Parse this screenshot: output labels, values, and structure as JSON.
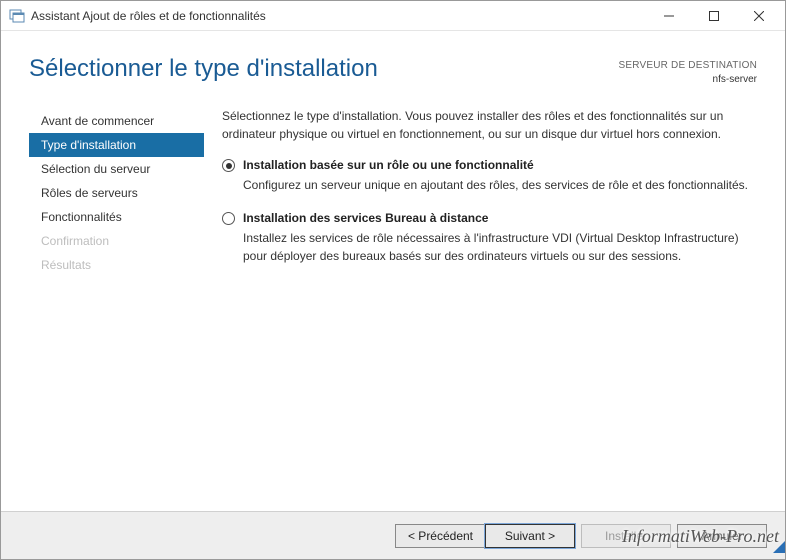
{
  "window": {
    "title": "Assistant Ajout de rôles et de fonctionnalités"
  },
  "header": {
    "page_title": "Sélectionner le type d'installation",
    "destination_label": "SERVEUR DE DESTINATION",
    "destination_value": "nfs-server"
  },
  "steps": [
    {
      "label": "Avant de commencer",
      "state": "done"
    },
    {
      "label": "Type d'installation",
      "state": "active"
    },
    {
      "label": "Sélection du serveur",
      "state": "pending"
    },
    {
      "label": "Rôles de serveurs",
      "state": "pending"
    },
    {
      "label": "Fonctionnalités",
      "state": "pending"
    },
    {
      "label": "Confirmation",
      "state": "disabled"
    },
    {
      "label": "Résultats",
      "state": "disabled"
    }
  ],
  "panel": {
    "intro": "Sélectionnez le type d'installation. Vous pouvez installer des rôles et des fonctionnalités sur un ordinateur physique ou virtuel en fonctionnement, ou sur un disque dur virtuel hors connexion.",
    "options": [
      {
        "selected": true,
        "title": "Installation basée sur un rôle ou une fonctionnalité",
        "desc": "Configurez un serveur unique en ajoutant des rôles, des services de rôle et des fonctionnalités."
      },
      {
        "selected": false,
        "title": "Installation des services Bureau à distance",
        "desc": "Installez les services de rôle nécessaires à l'infrastructure VDI (Virtual Desktop Infrastructure) pour déployer des bureaux basés sur des ordinateurs virtuels ou sur des sessions."
      }
    ]
  },
  "buttons": {
    "previous": "< Précédent",
    "next": "Suivant >",
    "install": "Installer",
    "cancel": "Annuler"
  },
  "watermark": "InformatiWeb-Pro.net"
}
